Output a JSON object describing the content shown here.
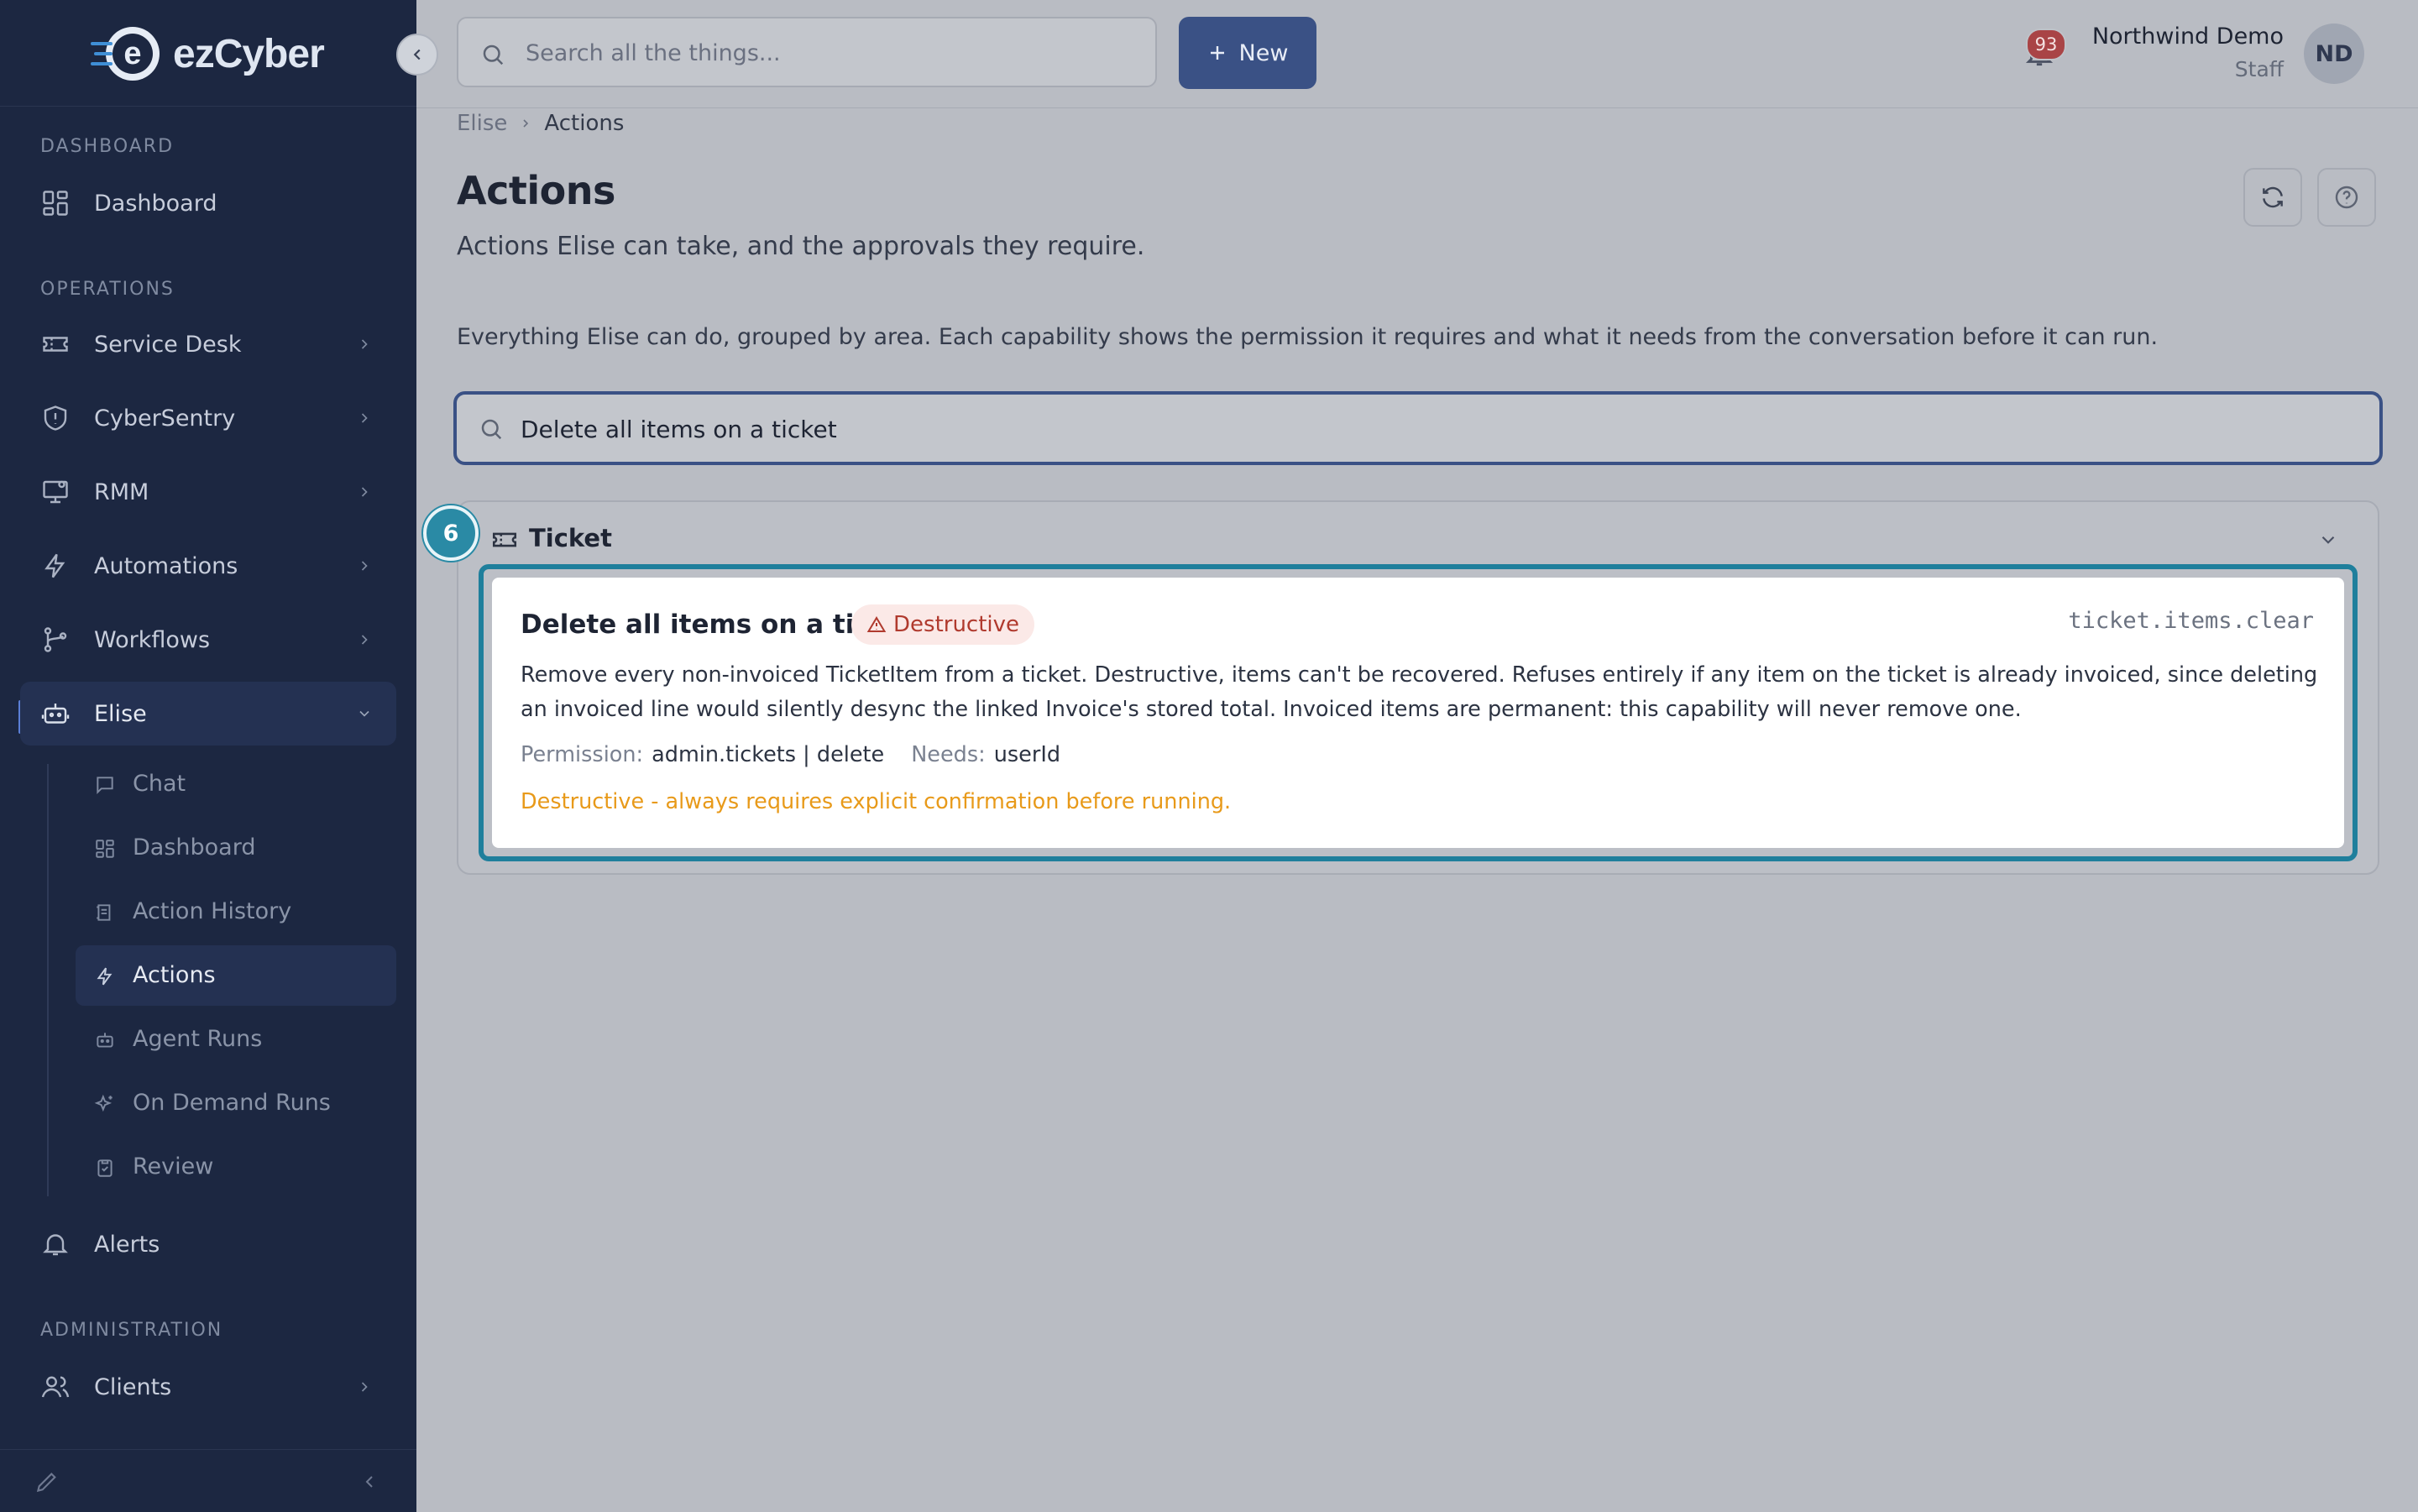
{
  "app": {
    "logo_text": "ezCyber"
  },
  "sidebar": {
    "sections": {
      "dashboard": "DASHBOARD",
      "operations": "OPERATIONS",
      "administration": "ADMINISTRATION"
    },
    "items": {
      "dashboard": "Dashboard",
      "service_desk": "Service Desk",
      "cybersentry": "CyberSentry",
      "rmm": "RMM",
      "automations": "Automations",
      "workflows": "Workflows",
      "elise": "Elise",
      "alerts": "Alerts",
      "clients": "Clients"
    },
    "elise_sub": {
      "chat": "Chat",
      "dashboard": "Dashboard",
      "action_history": "Action History",
      "actions": "Actions",
      "agent_runs": "Agent Runs",
      "on_demand_runs": "On Demand Runs",
      "review": "Review"
    }
  },
  "topbar": {
    "search_placeholder": "Search all the things...",
    "new_label": "New",
    "notification_count": "93",
    "user_name": "Northwind Demo",
    "user_role": "Staff",
    "avatar_initials": "ND"
  },
  "breadcrumb": {
    "parent": "Elise",
    "current": "Actions"
  },
  "page": {
    "title": "Actions",
    "subtitle": "Actions Elise can take, and the approvals they require.",
    "description": "Everything Elise can do, grouped by area. Each capability shows the permission it requires and what it needs from the conversation before it can run.",
    "filter_value": "Delete all items on a ticket"
  },
  "group": {
    "step_number": "6",
    "title": "Ticket"
  },
  "capability": {
    "title": "Delete all items on a ticket",
    "tag": "Destructive",
    "code": "ticket.items.clear",
    "description": "Remove every non-invoiced TicketItem from a ticket. Destructive, items can't be recovered. Refuses entirely if any item on the ticket is already invoiced, since deleting an invoiced line would silently desync the linked Invoice's stored total. Invoiced items are permanent: this capability will never remove one.",
    "permission_label": "Permission:",
    "permission_value": "admin.tickets | delete",
    "needs_label": "Needs:",
    "needs_value": "userId",
    "warning": "Destructive - always requires explicit confirmation before running."
  },
  "colors": {
    "sidebar_bg": "#1c2741",
    "accent": "#3a5185",
    "highlight": "#1f7f9c",
    "destructive": "#b03a2e",
    "warning": "#e89a1a"
  }
}
